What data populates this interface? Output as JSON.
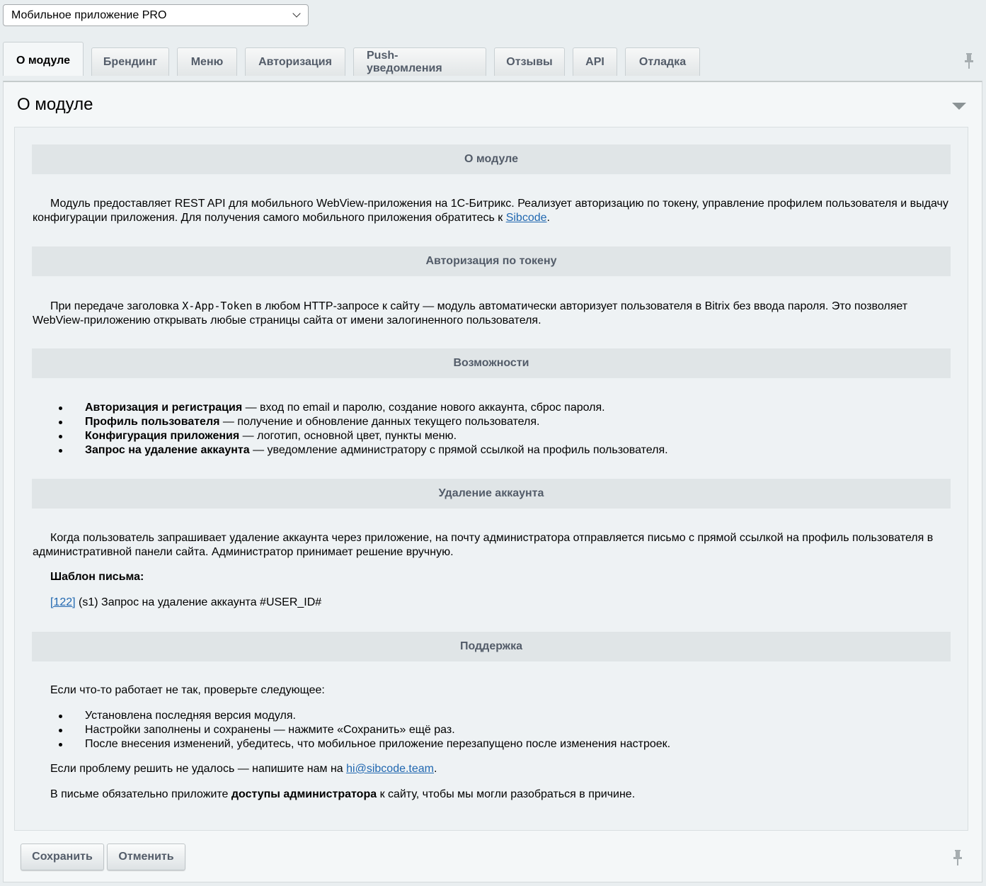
{
  "module_select": {
    "value": "Мобильное приложение PRO"
  },
  "tabs": [
    {
      "label": "О модуле",
      "active": true
    },
    {
      "label": "Брендинг",
      "active": false
    },
    {
      "label": "Меню",
      "active": false
    },
    {
      "label": "Авторизация",
      "active": false
    },
    {
      "label": "Push-уведомления",
      "active": false
    },
    {
      "label": "Отзывы",
      "active": false
    },
    {
      "label": "API",
      "active": false
    },
    {
      "label": "Отладка",
      "active": false
    }
  ],
  "panel": {
    "title": "О модуле"
  },
  "sections": {
    "about": {
      "heading": "О модуле",
      "text_before_link": "Модуль предоставляет REST API для мобильного WebView-приложения на 1С-Битрикс. Реализует авторизацию по токену, управление профилем пользователя и выдачу конфигурации приложения. Для получения самого мобильного приложения обратитесь к ",
      "link": "Sibcode",
      "text_after_link": "."
    },
    "token_auth": {
      "heading": "Авторизация по токену",
      "text_before_code": "При передаче заголовка ",
      "code": "X-App-Token",
      "text_after_code": " в любом HTTP-запросе к сайту — модуль автоматически авторизует пользователя в Bitrix без ввода пароля. Это позволяет WebView-приложению открывать любые страницы сайта от имени залогиненного пользователя."
    },
    "features": {
      "heading": "Возможности",
      "items": [
        {
          "bold": "Авторизация и регистрация",
          "text": " — вход по email и паролю, создание нового аккаунта, сброс пароля."
        },
        {
          "bold": "Профиль пользователя",
          "text": " — получение и обновление данных текущего пользователя."
        },
        {
          "bold": "Конфигурация приложения",
          "text": " — логотип, основной цвет, пункты меню."
        },
        {
          "bold": "Запрос на удаление аккаунта",
          "text": " — уведомление администратору с прямой ссылкой на профиль пользователя."
        }
      ]
    },
    "deletion": {
      "heading": "Удаление аккаунта",
      "text": "Когда пользователь запрашивает удаление аккаунта через приложение, на почту администратора отправляется письмо с прямой ссылкой на профиль пользователя в административной панели сайта. Администратор принимает решение вручную.",
      "template_label": "Шаблон письма:",
      "template_link": "[122]",
      "template_text": " (s1) Запрос на удаление аккаунта #USER_ID#"
    },
    "support": {
      "heading": "Поддержка",
      "intro": "Если что-то работает не так, проверьте следующее:",
      "items": [
        "Установлена последняя версия модуля.",
        "Настройки заполнены и сохранены — нажмите «Сохранить» ещё раз.",
        "После внесения изменений, убедитесь, что мобильное приложение перезапущено после изменения настроек."
      ],
      "contact_before": "Если проблему решить не удалось — напишите нам на ",
      "contact_email": "hi@sibcode.team",
      "contact_after": ".",
      "note_before": "В письме обязательно приложите ",
      "note_bold": "доступы администратора",
      "note_after": " к сайту, чтобы мы могли разобраться в причине."
    }
  },
  "buttons": {
    "save": "Сохранить",
    "cancel": "Отменить"
  }
}
